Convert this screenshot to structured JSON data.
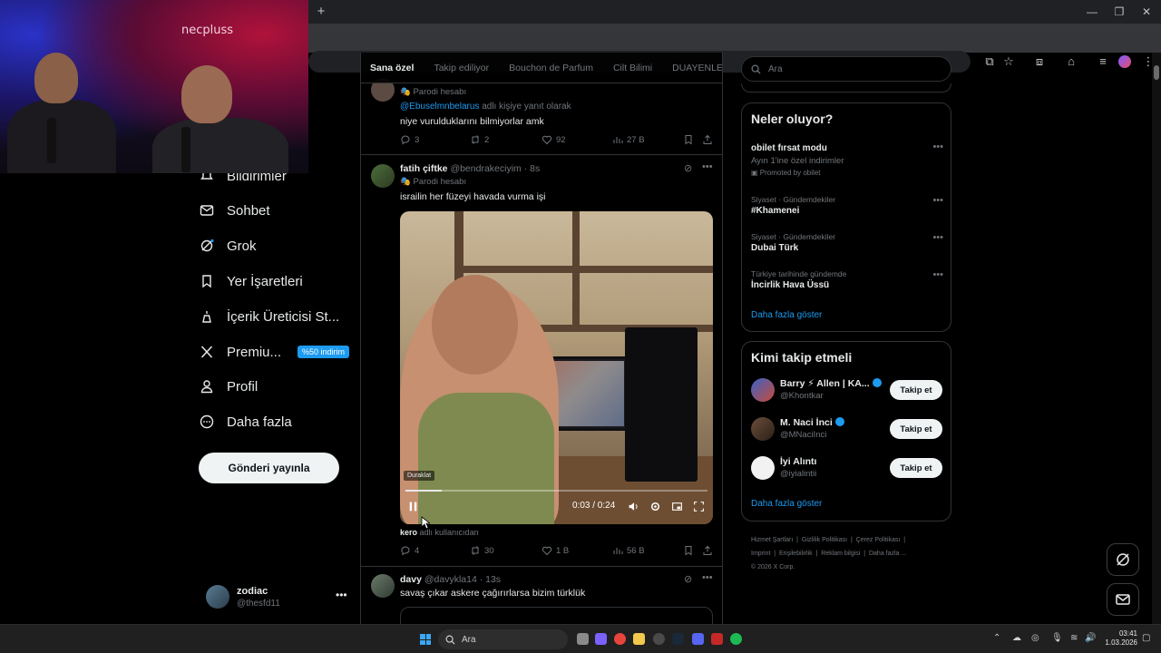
{
  "webcam": {
    "brand": "necpluss"
  },
  "nav": {
    "items": [
      {
        "label": "Bildirimler"
      },
      {
        "label": "Sohbet"
      },
      {
        "label": "Grok"
      },
      {
        "label": "Yer İşaretleri"
      },
      {
        "label": "İçerik Üreticisi St..."
      },
      {
        "label": "Premiu...",
        "badge": "%50 indirim"
      },
      {
        "label": "Profil"
      },
      {
        "label": "Daha fazla"
      }
    ],
    "post_button": "Gönderi yayınla",
    "account": {
      "name": "zodiac",
      "handle": "@thesfd11"
    }
  },
  "feed_tabs": [
    "Sana özel",
    "Takip ediliyor",
    "Bouchon de Parfum",
    "Cilt Bilimi",
    "DUAYENLER"
  ],
  "tweets": [
    {
      "parody": "Parodi hesabı",
      "reply_prefix": "@Ebuselmnbelarus",
      "reply_suffix": "adlı kişiye yanıt olarak",
      "text": "niye vurulduklarını bilmiyorlar amk",
      "replies": "3",
      "reposts": "2",
      "likes": "92",
      "views": "27 B"
    },
    {
      "name": "fatih çiftke",
      "handle": "@bendrakeciyim · 8s",
      "parody": "Parodi hesabı",
      "text": "israilin her füzeyi havada vurma işi",
      "video": {
        "paused_label": "Duraklat",
        "time": "0:03 / 0:24",
        "progress": 0.12
      },
      "credit_user": "kero",
      "credit_suffix": "adlı kullanıcıdan",
      "replies": "4",
      "reposts": "30",
      "likes": "1 B",
      "views": "56 B"
    },
    {
      "name": "davy",
      "handle": "@davykla14 · 13s",
      "text": "savaş çıkar askere çağırırlarsa bizim türklük"
    }
  ],
  "search": {
    "placeholder": "Ara"
  },
  "trends": {
    "title": "Neler oluyor?",
    "items": [
      {
        "name": "obilet fırsat modu",
        "sub": "Ayın 1'ine özel indirimler",
        "promo": "Promoted by obilet"
      },
      {
        "context": "Siyaset · Gündemdekiler",
        "name": "#Khamenei"
      },
      {
        "context": "Siyaset · Gündemdekiler",
        "name": "Dubai Türk"
      },
      {
        "context": "Türkiye tarihinde gündemde",
        "name": "İncirlik Hava Üssü"
      }
    ],
    "show_more": "Daha fazla göster"
  },
  "who_to_follow": {
    "title": "Kimi takip etmeli",
    "items": [
      {
        "name": "Barry ⚡ Allen | KA...",
        "handle": "@Khontkar",
        "button": "Takip et"
      },
      {
        "name": "M. Naci İnci",
        "handle": "@MNaciInci",
        "button": "Takip et"
      },
      {
        "name": "İyi Alıntı",
        "handle": "@iyialintii",
        "button": "Takip et"
      }
    ],
    "show_more": "Daha fazla göster"
  },
  "footer": {
    "links": [
      "Hizmet Şartları",
      "Gizlilik Politikası",
      "Çerez Politikası",
      "Imprint",
      "Erişilebilirlik",
      "Reklam bilgisi",
      "Daha fazla ..."
    ],
    "copyright": "© 2026 X Corp."
  },
  "taskbar": {
    "search": "Ara",
    "time": "03:41",
    "date": "1.03.2026"
  },
  "colors": {
    "accent": "#1d9bf0",
    "background": "#000000"
  }
}
